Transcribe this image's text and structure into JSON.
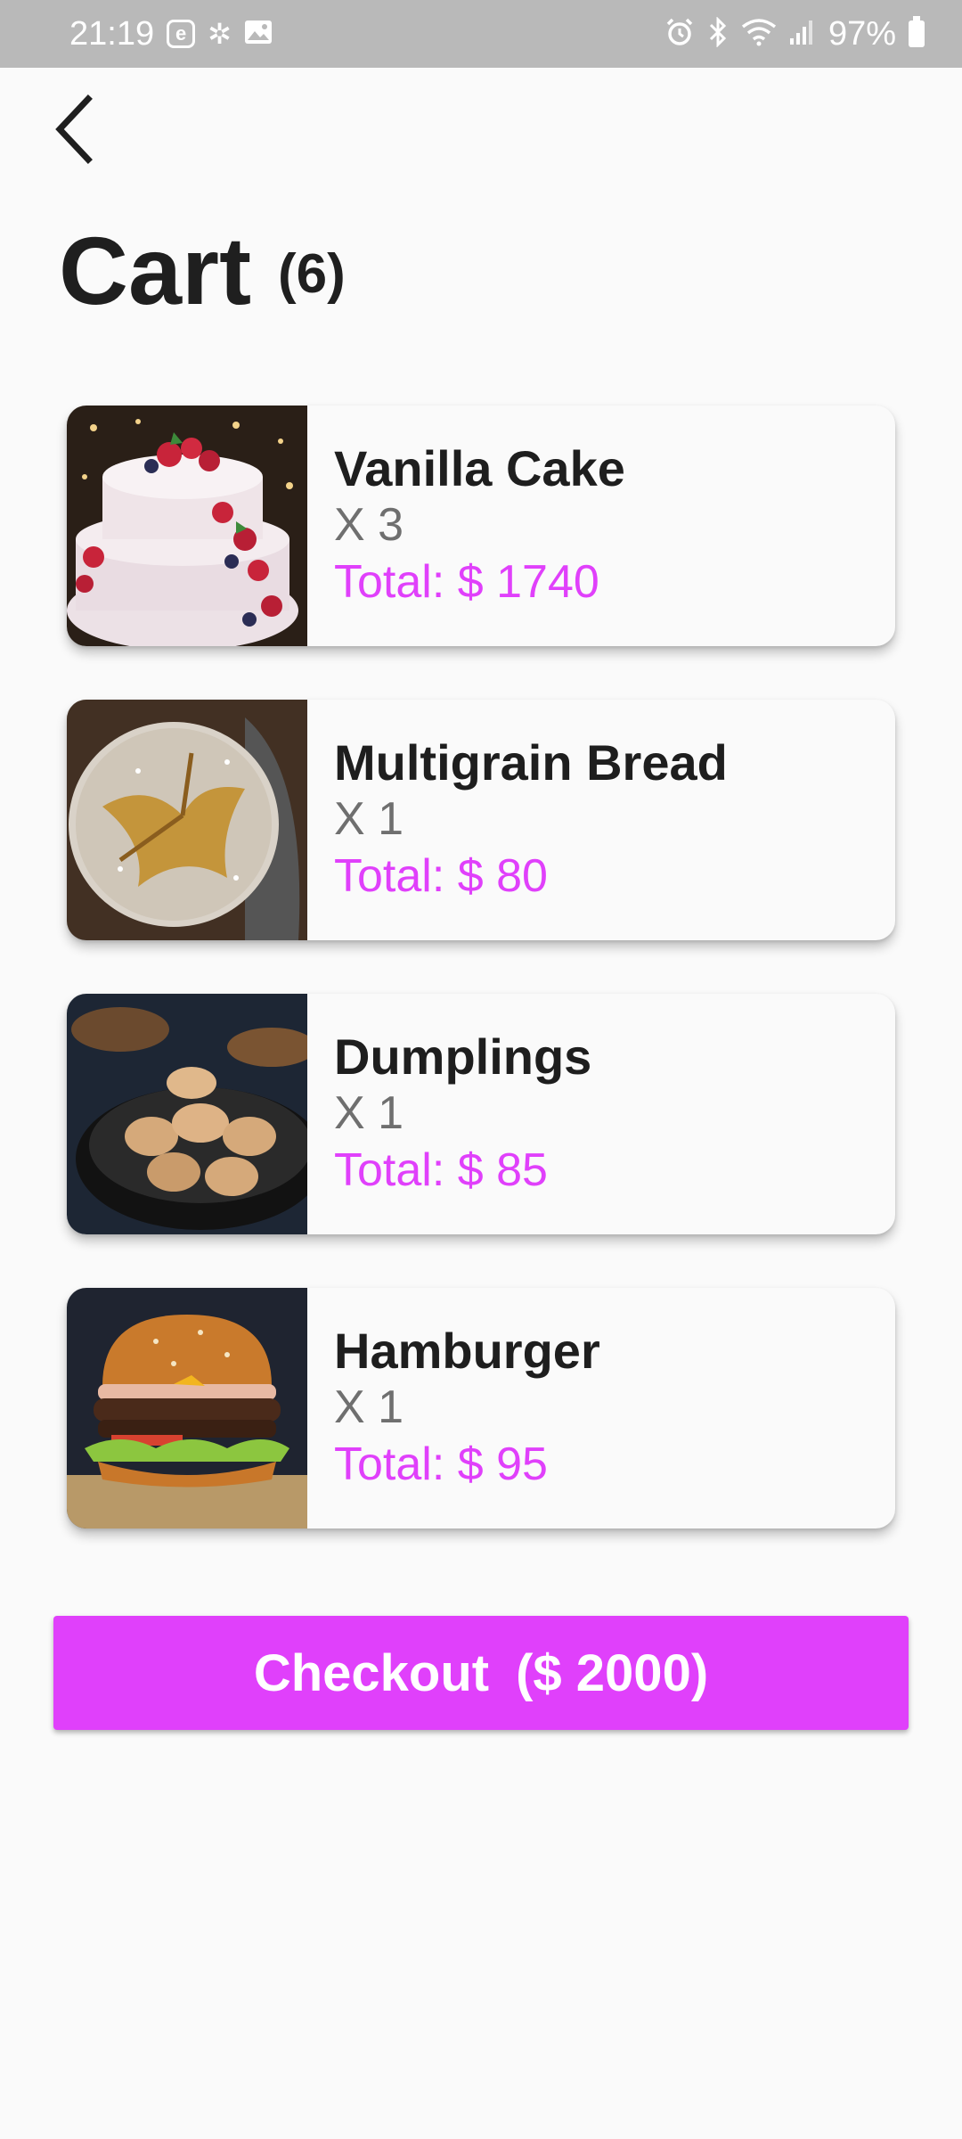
{
  "status_bar": {
    "time": "21:19",
    "battery": "97%",
    "icons_left": [
      "e-badge-icon",
      "fan-icon",
      "image-icon"
    ],
    "icons_right": [
      "alarm-icon",
      "bluetooth-icon",
      "wifi-icon",
      "signal-icon",
      "battery-icon"
    ]
  },
  "header": {
    "back_icon": "chevron-left-icon",
    "title": "Cart",
    "count": "(6)"
  },
  "cart": {
    "items": [
      {
        "name": "Vanilla Cake",
        "qty": "X 3",
        "total": "Total: $ 1740",
        "image": "vanilla-cake-photo"
      },
      {
        "name": "Multigrain Bread",
        "qty": "X 1",
        "total": "Total: $ 80",
        "image": "multigrain-bread-photo"
      },
      {
        "name": "Dumplings",
        "qty": "X 1",
        "total": "Total: $ 85",
        "image": "dumplings-photo"
      },
      {
        "name": "Hamburger",
        "qty": "X 1",
        "total": "Total: $ 95",
        "image": "hamburger-photo"
      }
    ]
  },
  "checkout": {
    "label": "Checkout",
    "amount": "($ 2000)"
  },
  "colors": {
    "accent": "#e040fb",
    "background": "#fafafa",
    "status_bar": "#b9b9b9",
    "title": "#1f1f1f",
    "quantity": "#6f6f6f"
  }
}
